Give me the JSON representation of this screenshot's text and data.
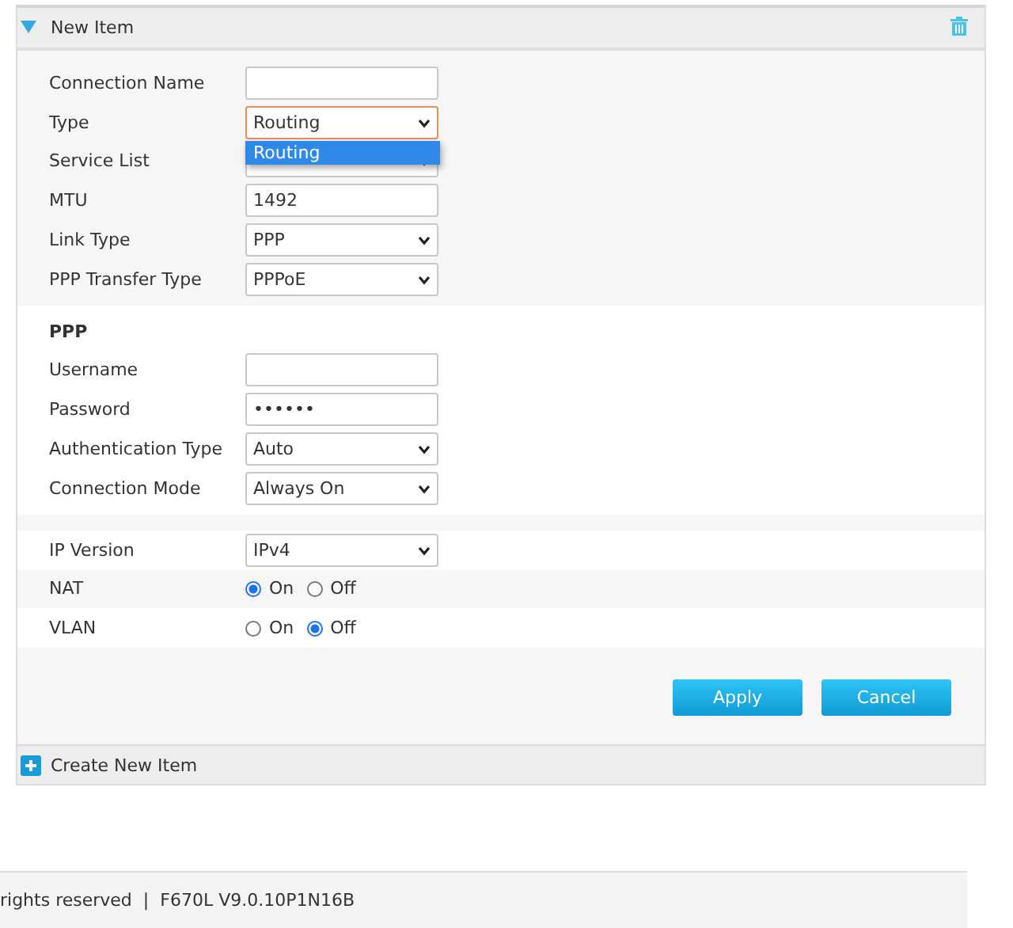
{
  "panel": {
    "title": "New Item",
    "expanded": true
  },
  "groups": [
    {
      "rows": [
        {
          "kind": "text",
          "label": "Connection Name",
          "value": ""
        },
        {
          "kind": "select",
          "label": "Type",
          "value": "Routing",
          "focused": true,
          "open_options": [
            {
              "label": "Routing",
              "selected": true
            }
          ]
        },
        {
          "kind": "select",
          "label": "Service List"
        },
        {
          "kind": "text",
          "label": "MTU",
          "value": "1492"
        },
        {
          "kind": "select",
          "label": "Link Type",
          "value": "PPP"
        },
        {
          "kind": "select",
          "label": "PPP Transfer Type",
          "value": "PPPoE"
        }
      ]
    },
    {
      "rows": [
        {
          "kind": "heading",
          "label": "PPP"
        },
        {
          "kind": "text",
          "label": "Username",
          "value": ""
        },
        {
          "kind": "password",
          "label": "Password",
          "value": "••••••"
        },
        {
          "kind": "select",
          "label": "Authentication Type",
          "value": "Auto"
        },
        {
          "kind": "select",
          "label": "Connection Mode",
          "value": "Always On"
        }
      ]
    },
    {
      "rows": [
        {
          "kind": "select",
          "label": "IP Version",
          "value": "IPv4"
        },
        {
          "kind": "radio",
          "label": "NAT",
          "options": [
            {
              "label": "On",
              "selected": true
            },
            {
              "label": "Off",
              "selected": false
            }
          ]
        },
        {
          "kind": "radio",
          "label": "VLAN",
          "options": [
            {
              "label": "On",
              "selected": false
            },
            {
              "label": "Off",
              "selected": true
            }
          ]
        }
      ]
    }
  ],
  "buttons": [
    "Apply",
    "Cancel"
  ],
  "create_item": "Create New Item",
  "footer": {
    "copyright": "rights reserved",
    "separator": "|",
    "version": "F670L V9.0.10P1N16B"
  }
}
